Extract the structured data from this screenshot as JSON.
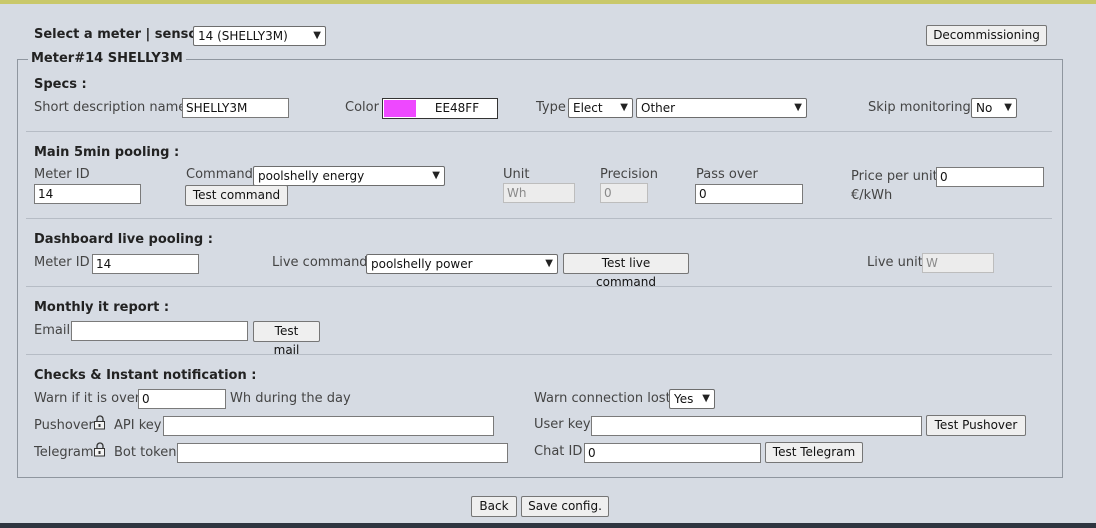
{
  "header": {
    "select_label": "Select a meter | sensor :",
    "meter_select": "14 (SHELLY3M)",
    "decommission_label": "Decommissioning"
  },
  "legend": "Meter#14 SHELLY3M",
  "specs": {
    "title": "Specs :",
    "short_desc_label": "Short description name",
    "short_desc_value": "SHELLY3M",
    "color_label": "Color",
    "color_value": "EE48FF",
    "color_hex": "#EE48FF",
    "type_label": "Type",
    "type_value": "Elect",
    "subtype_value": "Other",
    "skip_label": "Skip monitoring",
    "skip_value": "No"
  },
  "main": {
    "title": "Main 5min pooling :",
    "meter_id_label": "Meter ID",
    "meter_id_value": "14",
    "command_label": "Command",
    "command_value": "poolshelly energy",
    "test_command_label": "Test command",
    "unit_label": "Unit",
    "unit_value": "Wh",
    "precision_label": "Precision",
    "precision_value": "0",
    "passover_label": "Pass over",
    "passover_value": "0",
    "price_label": "Price per unit",
    "price_value": "0",
    "price_unit": "€/kWh"
  },
  "live": {
    "title": "Dashboard live pooling :",
    "meter_id_label": "Meter ID",
    "meter_id_value": "14",
    "command_label": "Live command",
    "command_value": "poolshelly power",
    "test_label": "Test live command",
    "unit_label": "Live unit",
    "unit_value": "W"
  },
  "report": {
    "title": "Monthly it report :",
    "email_label": "Email",
    "email_value": "",
    "test_mail_label": "Test mail"
  },
  "checks": {
    "title": "Checks & Instant notification :",
    "warn_label": "Warn if it is over",
    "warn_value": "0",
    "warn_suffix": "Wh during the day",
    "pushover_label": "Pushover",
    "api_key_label": "API key",
    "api_key_value": "",
    "telegram_label": "Telegram",
    "bot_token_label": "Bot token",
    "bot_token_value": "",
    "warn_conn_label": "Warn connection lost",
    "warn_conn_value": "Yes",
    "user_key_label": "User key",
    "user_key_value": "",
    "test_pushover_label": "Test Pushover",
    "chat_id_label": "Chat ID",
    "chat_id_value": "0",
    "test_telegram_label": "Test Telegram"
  },
  "footer": {
    "back_label": "Back",
    "save_label": "Save config."
  },
  "icons": {
    "lock": "padlock-icon",
    "dropdown": "chevron-down-icon"
  }
}
